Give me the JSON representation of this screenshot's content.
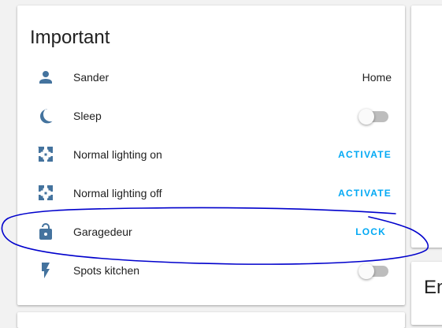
{
  "card": {
    "title": "Important",
    "rows": [
      {
        "icon": "person-icon",
        "label": "Sander",
        "state": "Home"
      },
      {
        "icon": "moon-icon",
        "label": "Sleep",
        "toggle_on": false
      },
      {
        "icon": "scene-icon",
        "label": "Normal lighting on",
        "action": "ACTIVATE"
      },
      {
        "icon": "scene-icon",
        "label": "Normal lighting off",
        "action": "ACTIVATE"
      },
      {
        "icon": "lock-open-icon",
        "label": "Garagedeur",
        "action": "LOCK"
      },
      {
        "icon": "flash-icon",
        "label": "Spots kitchen",
        "toggle_on": false
      }
    ]
  },
  "right_card_peek": "En",
  "colors": {
    "icon": "#44739e",
    "action": "#03a9f4",
    "annotation": "#0000cc"
  }
}
